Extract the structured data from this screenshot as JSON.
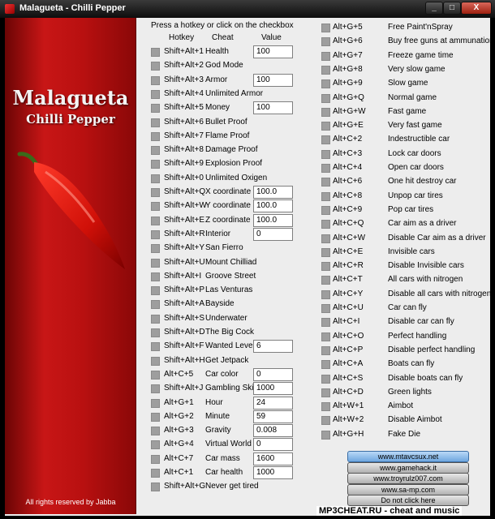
{
  "window": {
    "title": "Malagueta - Chilli Pepper",
    "min_label": "_",
    "max_label": "□",
    "close_label": "X"
  },
  "branding": {
    "line1": "Malagueta",
    "line2": "Chilli Pepper",
    "rights": "All rights reserved by Jabba",
    "pepper_icon": "chili-pepper"
  },
  "header": {
    "instruction": "Press a hotkey or click on the checkbox",
    "col_hotkey": "Hotkey",
    "col_cheat": "Cheat",
    "col_value": "Value"
  },
  "left_cheats": [
    {
      "hotkey": "Shift+Alt+1",
      "name": "Health",
      "value": "100"
    },
    {
      "hotkey": "Shift+Alt+2",
      "name": "God Mode"
    },
    {
      "hotkey": "Shift+Alt+3",
      "name": "Armor",
      "value": "100"
    },
    {
      "hotkey": "Shift+Alt+4",
      "name": "Unlimited Armor"
    },
    {
      "hotkey": "Shift+Alt+5",
      "name": "Money",
      "value": "100"
    },
    {
      "hotkey": "Shift+Alt+6",
      "name": "Bullet Proof"
    },
    {
      "hotkey": "Shift+Alt+7",
      "name": "Flame Proof"
    },
    {
      "hotkey": "Shift+Alt+8",
      "name": "Damage Proof"
    },
    {
      "hotkey": "Shift+Alt+9",
      "name": "Explosion Proof"
    },
    {
      "hotkey": "Shift+Alt+0",
      "name": "Unlimited Oxigen"
    },
    {
      "hotkey": "Shift+Alt+Q",
      "name": "X coordinate",
      "value": "100.0"
    },
    {
      "hotkey": "Shift+Alt+W",
      "name": "Y coordinate",
      "value": "100.0"
    },
    {
      "hotkey": "Shift+Alt+E",
      "name": "Z coordinate",
      "value": "100.0"
    },
    {
      "hotkey": "Shift+Alt+R",
      "name": "Interior",
      "value": "0"
    },
    {
      "hotkey": "Shift+Alt+Y",
      "name": "San Fierro"
    },
    {
      "hotkey": "Shift+Alt+U",
      "name": "Mount Chilliad"
    },
    {
      "hotkey": "Shift+Alt+I",
      "name": "Groove Street"
    },
    {
      "hotkey": "Shift+Alt+P",
      "name": "Las Venturas"
    },
    {
      "hotkey": "Shift+Alt+A",
      "name": "Bayside"
    },
    {
      "hotkey": "Shift+Alt+S",
      "name": "Underwater"
    },
    {
      "hotkey": "Shift+Alt+D",
      "name": "The Big Cock"
    },
    {
      "hotkey": "Shift+Alt+F",
      "name": "Wanted Level",
      "value": "6"
    },
    {
      "hotkey": "Shift+Alt+H",
      "name": "Get Jetpack"
    },
    {
      "hotkey": "Alt+C+5",
      "name": "Car color",
      "value": "0"
    },
    {
      "hotkey": "Shift+Alt+J",
      "name": "Gambling Skill",
      "value": "1000"
    },
    {
      "hotkey": "Alt+G+1",
      "name": "Hour",
      "value": "24"
    },
    {
      "hotkey": "Alt+G+2",
      "name": "Minute",
      "value": "59"
    },
    {
      "hotkey": "Alt+G+3",
      "name": "Gravity",
      "value": "0.008"
    },
    {
      "hotkey": "Alt+G+4",
      "name": "Virtual World",
      "value": "0"
    },
    {
      "hotkey": "Alt+C+7",
      "name": "Car mass",
      "value": "1600"
    },
    {
      "hotkey": "Alt+C+1",
      "name": "Car health",
      "value": "1000"
    },
    {
      "hotkey": "Shift+Alt+G",
      "name": "Never get tired"
    }
  ],
  "right_cheats": [
    {
      "hotkey": "Alt+G+5",
      "name": "Free Paint'nSpray"
    },
    {
      "hotkey": "Alt+G+6",
      "name": "Buy free guns at ammunation"
    },
    {
      "hotkey": "Alt+G+7",
      "name": "Freeze game time"
    },
    {
      "hotkey": "Alt+G+8",
      "name": "Very slow game"
    },
    {
      "hotkey": "Alt+G+9",
      "name": "Slow game"
    },
    {
      "hotkey": "Alt+G+Q",
      "name": "Normal game"
    },
    {
      "hotkey": "Alt+G+W",
      "name": "Fast game"
    },
    {
      "hotkey": "Alt+G+E",
      "name": "Very fast game"
    },
    {
      "hotkey": "Alt+C+2",
      "name": "Indestructible car"
    },
    {
      "hotkey": "Alt+C+3",
      "name": "Lock car doors"
    },
    {
      "hotkey": "Alt+C+4",
      "name": "Open car doors"
    },
    {
      "hotkey": "Alt+C+6",
      "name": "One hit destroy car"
    },
    {
      "hotkey": "Alt+C+8",
      "name": "Unpop car tires"
    },
    {
      "hotkey": "Alt+C+9",
      "name": "Pop car tires"
    },
    {
      "hotkey": "Alt+C+Q",
      "name": "Car aim as a driver"
    },
    {
      "hotkey": "Alt+C+W",
      "name": "Disable Car aim as a driver"
    },
    {
      "hotkey": "Alt+C+E",
      "name": "Invisible cars"
    },
    {
      "hotkey": "Alt+C+R",
      "name": "Disable Invisible cars"
    },
    {
      "hotkey": "Alt+C+T",
      "name": "All cars with nitrogen"
    },
    {
      "hotkey": "Alt+C+Y",
      "name": "Disable all cars with nitrogen"
    },
    {
      "hotkey": "Alt+C+U",
      "name": "Car can fly"
    },
    {
      "hotkey": "Alt+C+I",
      "name": "Disable car can fly"
    },
    {
      "hotkey": "Alt+C+O",
      "name": "Perfect handling"
    },
    {
      "hotkey": "Alt+C+P",
      "name": "Disable perfect handling"
    },
    {
      "hotkey": "Alt+C+A",
      "name": "Boats can fly"
    },
    {
      "hotkey": "Alt+C+S",
      "name": "Disable boats can fly"
    },
    {
      "hotkey": "Alt+C+D",
      "name": "Green lights"
    },
    {
      "hotkey": "Alt+W+1",
      "name": "Aimbot"
    },
    {
      "hotkey": "Alt+W+2",
      "name": "Disable Aimbot"
    },
    {
      "hotkey": "Alt+G+H",
      "name": "Fake Die"
    }
  ],
  "links": [
    {
      "label": "www.mtavcsux.net",
      "active": true
    },
    {
      "label": "www.gamehack.it"
    },
    {
      "label": "www.troyrulz007.com"
    },
    {
      "label": "www.sa-mp.com"
    },
    {
      "label": "Do not click here"
    }
  ],
  "watermark": "MP3CHEAT.RU - cheat and music",
  "colors": {
    "panel_red": "#c81616",
    "window_bg": "#ededed",
    "checkbox": "#9e9e9e",
    "link_active": "#6fa7df"
  }
}
